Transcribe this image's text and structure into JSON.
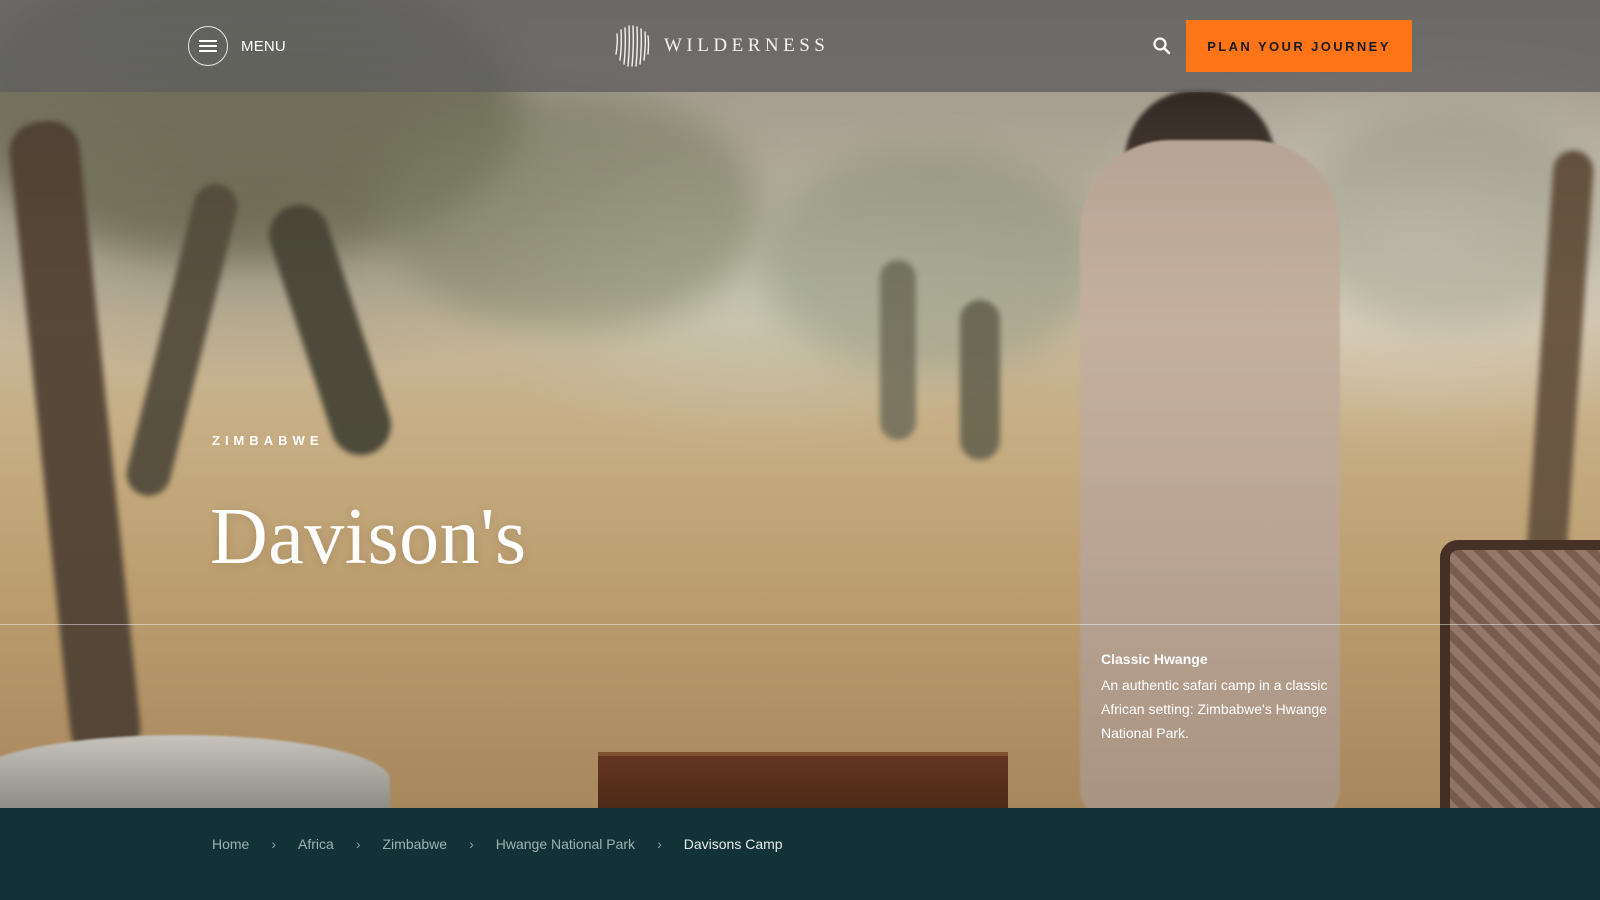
{
  "header": {
    "menu_label": "MENU",
    "logo_text": "WILDERNESS",
    "cta_label": "PLAN YOUR JOURNEY"
  },
  "hero": {
    "eyebrow": "ZIMBABWE",
    "title": "Davison's",
    "feature_title": "Classic Hwange",
    "feature_description": "An authentic safari camp in a classic African setting: Zimbabwe's Hwange National Park."
  },
  "breadcrumb": {
    "items": [
      "Home",
      "Africa",
      "Zimbabwe",
      "Hwange National Park",
      "Davisons Camp"
    ],
    "separator": "›"
  },
  "colors": {
    "accent": "#ff7417",
    "breadcrumb_bg": "#123238",
    "header_overlay": "rgba(95,95,95,0.78)"
  },
  "icons": [
    "hamburger-icon",
    "wilderness-logo-icon",
    "search-icon"
  ]
}
